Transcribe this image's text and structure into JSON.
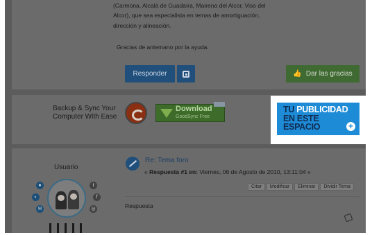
{
  "post_top": {
    "lines": [
      "(Carmona, Alcalá de Guadaíra, Mairena del Alcor, Viso del",
      "Alcor), que sea especialista en temas de amortiguación,",
      "dirección y alineación.",
      "Gracias de antemano por la ayuda."
    ],
    "reply_button": "Responder",
    "thanks_button": "Dar las gracias"
  },
  "ad": {
    "text": "Backup & Sync Your Computer With Ease",
    "download_title": "Download",
    "download_subtitle": "GoodSync Free",
    "adchoices": "AdChoices",
    "promo_line1_a": "TU",
    "promo_line1_b": "PUBLICIDAD",
    "promo_line2": "EN ESTE",
    "promo_line3": "ESPACIO",
    "promo_plus": "+"
  },
  "post2": {
    "username": "Usuario",
    "title": "Re: Tema foro",
    "meta_prefix": "«",
    "meta_bold": "Respuesta #1 en:",
    "meta_date": "Viernes, 06 de Agosto de 2010, 13:11:04 »",
    "actions": [
      "Citar",
      "Modificar",
      "Eliminar",
      "Dividir Tema"
    ],
    "body": "Respuesta"
  },
  "icons": {
    "quote": "quote-icon",
    "thumb": "thumbs-up-icon",
    "post": "pencil-icon",
    "report": "report-icon"
  },
  "colors": {
    "overlay": "#5c5c5c",
    "primary": "#1f4f7a",
    "success": "#3f6a32",
    "promo": "#1e8bd6"
  }
}
